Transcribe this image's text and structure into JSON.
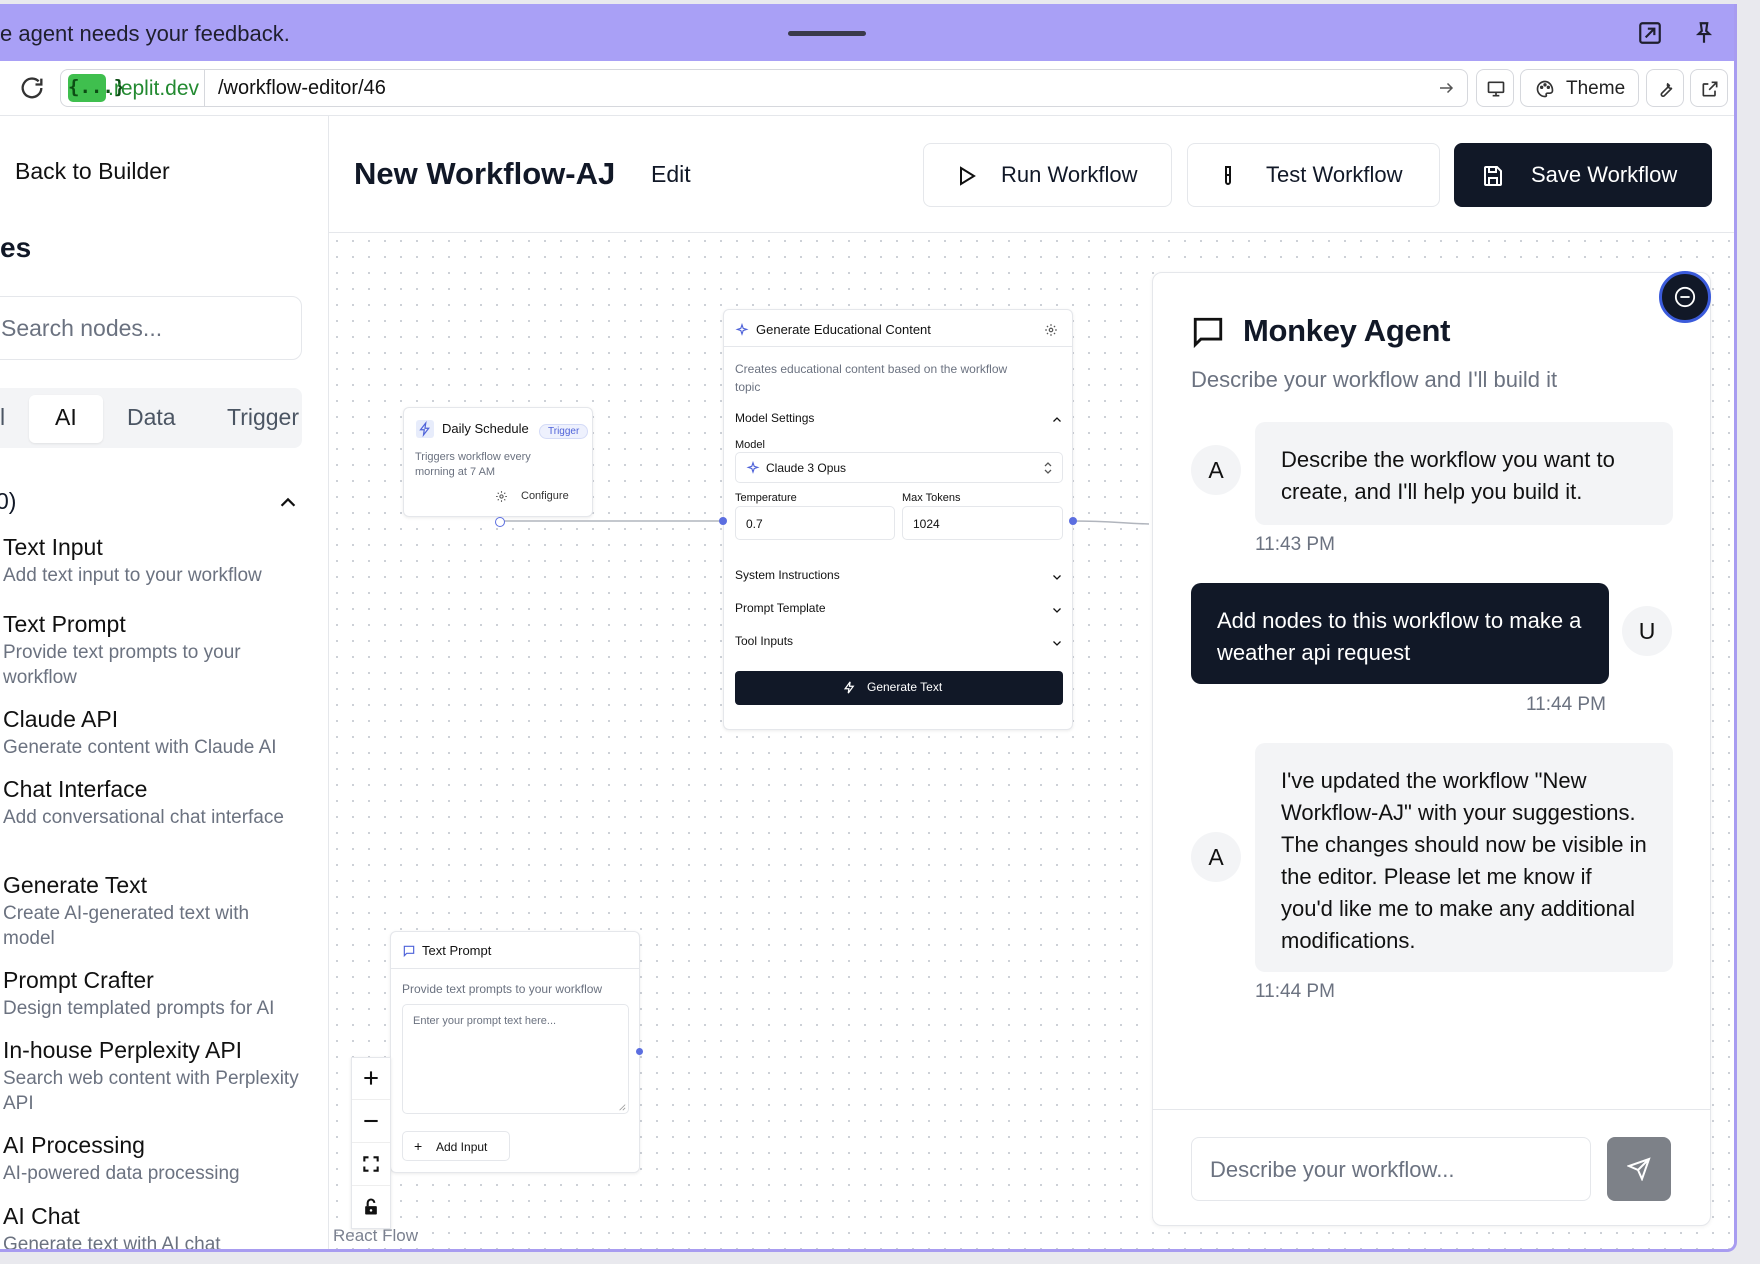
{
  "feedback_bar": {
    "message": "e agent needs your feedback."
  },
  "url_bar": {
    "badge": "{...}",
    "domain": ".replit.dev",
    "path": "/workflow-editor/46",
    "theme_label": "Theme"
  },
  "sidebar": {
    "back_label": "Back to Builder",
    "title": "es",
    "search_placeholder": "Search nodes...",
    "tabs": [
      {
        "label": "l"
      },
      {
        "label": "AI"
      },
      {
        "label": "Data"
      },
      {
        "label": "Trigger"
      }
    ],
    "category_label": "0)",
    "items": [
      {
        "title": "Text Input",
        "desc": "Add text input to your workflow"
      },
      {
        "title": "Text Prompt",
        "desc": "Provide text prompts to your workflow"
      },
      {
        "title": "Claude API",
        "desc": "Generate content with Claude AI"
      },
      {
        "title": "Chat Interface",
        "desc": "Add conversational chat interface"
      },
      {
        "title": "Generate Text",
        "desc": "Create AI-generated text with model"
      },
      {
        "title": "Prompt Crafter",
        "desc": "Design templated prompts for AI"
      },
      {
        "title": "In-house Perplexity API",
        "desc": "Search web content with Perplexity API"
      },
      {
        "title": "AI Processing",
        "desc": "AI-powered data processing"
      },
      {
        "title": "AI Chat",
        "desc": "Generate text with AI chat"
      }
    ]
  },
  "header": {
    "title": "New Workflow-AJ",
    "edit_label": "Edit",
    "run_label": "Run Workflow",
    "test_label": "Test Workflow",
    "save_label": "Save Workflow"
  },
  "canvas": {
    "watermark": "React Flow",
    "daily_schedule": {
      "title": "Daily Schedule",
      "badge": "Trigger",
      "desc": "Triggers workflow every morning at 7 AM",
      "configure": "Configure"
    },
    "generate_node": {
      "title": "Generate Educational Content",
      "desc": "Creates educational content based on the workflow topic",
      "model_settings": "Model Settings",
      "model_label": "Model",
      "model_value": "Claude 3 Opus",
      "temperature_label": "Temperature",
      "temperature_value": "0.7",
      "max_tokens_label": "Max Tokens",
      "max_tokens_value": "1024",
      "sections": [
        "System Instructions",
        "Prompt Template",
        "Tool Inputs"
      ],
      "button": "Generate Text"
    },
    "text_prompt_node": {
      "title": "Text Prompt",
      "desc": "Provide text prompts to your workflow",
      "placeholder": "Enter your prompt text here...",
      "add_input": "Add Input"
    }
  },
  "chat": {
    "title": "Monkey Agent",
    "subtitle": "Describe your workflow and I'll build it",
    "messages": [
      {
        "role": "A",
        "text": "Describe the workflow you want to create, and I'll help you build it.",
        "time": "11:43 PM"
      },
      {
        "role": "U",
        "text": "Add nodes to this workflow to make a weather api request",
        "time": "11:44 PM"
      },
      {
        "role": "A",
        "text": "I've updated the workflow \"New Workflow-AJ\" with your suggestions. The changes should now be visible in the editor. Please let me know if you'd like me to make any additional modifications.",
        "time": "11:44 PM"
      }
    ],
    "input_placeholder": "Describe your workflow..."
  },
  "colors": {
    "feedback_bar": "#a9a0f6",
    "primary_dark": "#111827",
    "handle": "#5b6ee0",
    "domain_green": "#238a31"
  }
}
